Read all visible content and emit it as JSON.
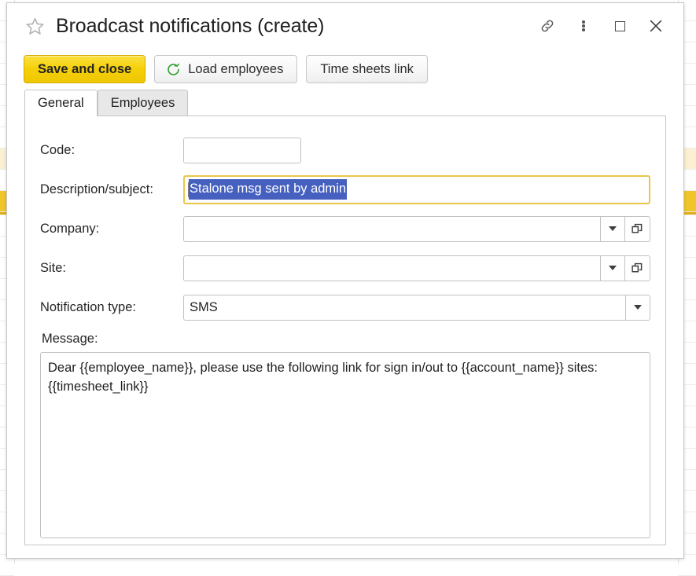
{
  "window": {
    "title": "Broadcast notifications (create)",
    "favorite_icon": "star-outline-icon",
    "actions": [
      {
        "name": "link-icon",
        "label": "Link"
      },
      {
        "name": "kebab-menu-icon",
        "label": "More"
      },
      {
        "name": "maximize-icon",
        "label": "Maximize"
      },
      {
        "name": "close-icon",
        "label": "Close"
      }
    ]
  },
  "toolbar": {
    "save_label": "Save and close",
    "load_employees_label": "Load employees",
    "load_employees_icon": "refresh-icon",
    "time_sheets_label": "Time sheets link"
  },
  "tabs": [
    {
      "label": "General",
      "active": true
    },
    {
      "label": "Employees",
      "active": false
    }
  ],
  "form": {
    "code": {
      "label": "Code:",
      "value": "",
      "placeholder": ""
    },
    "description": {
      "label": "Description/subject:",
      "value": "Stalone msg sent by admin",
      "selected": true,
      "focused": true
    },
    "company": {
      "label": "Company:",
      "value": "",
      "dropdown_icon": "chevron-down-icon",
      "lookup_icon": "open-window-icon"
    },
    "site": {
      "label": "Site:",
      "value": "",
      "dropdown_icon": "chevron-down-icon",
      "lookup_icon": "open-window-icon"
    },
    "notification_type": {
      "label": "Notification type:",
      "value": "SMS",
      "dropdown_icon": "chevron-down-icon"
    },
    "message": {
      "label": "Message:",
      "value": "Dear {{employee_name}}, please use the following link for sign in/out to {{account_name}} sites: {{timesheet_link}}"
    }
  },
  "colors": {
    "accent_yellow": "#f4cf06",
    "focus_border": "#e8c64a",
    "selection_blue": "#4560bf",
    "refresh_green": "#2aa02a"
  }
}
